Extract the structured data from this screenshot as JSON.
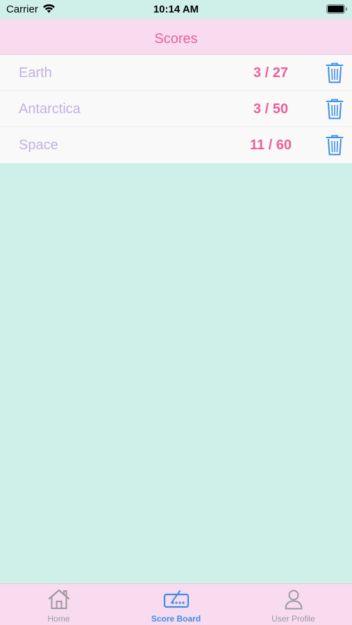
{
  "status_bar": {
    "carrier": "Carrier",
    "time": "10:14 AM",
    "icons": [
      "wifi-icon",
      "battery-icon"
    ]
  },
  "nav": {
    "title": "Scores"
  },
  "scores": [
    {
      "name": "Earth",
      "score": "3 / 27"
    },
    {
      "name": "Antarctica",
      "score": "3 / 50"
    },
    {
      "name": "Space",
      "score": "11 / 60"
    }
  ],
  "tabs": {
    "home": "Home",
    "score_board": "Score Board",
    "user_profile": "User Profile",
    "selected": "score_board"
  },
  "colors": {
    "background": "#cff0e8",
    "nav_background": "#f8dbef",
    "accent_pink": "#ec5e9c",
    "label_lavender": "#c2b1e1",
    "trash_blue": "#3a8ee8",
    "tab_inactive": "#9a9a9a"
  }
}
